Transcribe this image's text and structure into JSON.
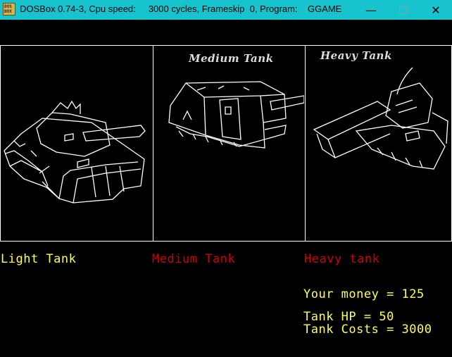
{
  "window": {
    "icon_text": "DOS\nBOX",
    "title": "DOSBox 0.74-3, Cpu speed:     3000 cycles, Frameskip  0, Program:    GGAME",
    "controls": {
      "minimize": "—",
      "maximize": "☐",
      "close": "✕"
    }
  },
  "tanks": [
    {
      "name": "Light Tank",
      "name_color": "#ffff55",
      "header": "",
      "selected": true
    },
    {
      "name": "Medium Tank",
      "name_color": "#cc0000",
      "header": "Medium Tank",
      "selected": false
    },
    {
      "name": "Heavy tank",
      "name_color": "#cc0000",
      "header": "Heavy Tank",
      "selected": false
    }
  ],
  "stats": {
    "money": "Your money = 125",
    "hp": "Tank HP = 50",
    "cost": "Tank Costs = 3000"
  },
  "colors": {
    "titlebar": "#17c3cc",
    "selected": "#ffff55",
    "unselected": "#cc0000",
    "stat_text": "#ffff55"
  }
}
